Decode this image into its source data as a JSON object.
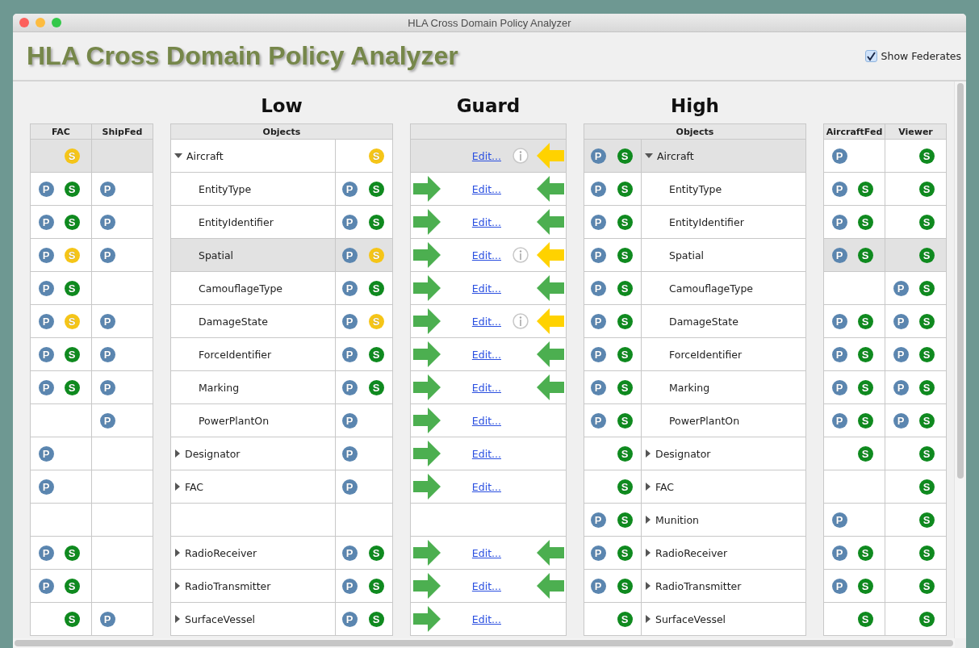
{
  "window": {
    "title": "HLA Cross Domain Policy Analyzer"
  },
  "header": {
    "title": "HLA Cross Domain Policy Analyzer",
    "show_federates": {
      "label": "Show Federates",
      "checked": true
    }
  },
  "sections": {
    "low": "Low",
    "guard": "Guard",
    "high": "High"
  },
  "low_federates": {
    "columns": [
      "FAC",
      "ShipFed"
    ]
  },
  "low_objects": {
    "column": "Objects"
  },
  "high_objects": {
    "column": "Objects"
  },
  "high_federates": {
    "columns": [
      "AircraftFed",
      "Viewer"
    ]
  },
  "rows": [
    {
      "expanded": true,
      "low_federates": {
        "highlighted": true,
        "cells": [
          {
            "s": {
              "text": "S",
              "color": "#f5c518"
            }
          },
          {}
        ]
      },
      "low": {
        "highlighted": false,
        "name": "Aircraft",
        "s": {
          "text": "S",
          "color": "#f5c518"
        }
      },
      "guard": {
        "highlighted": true,
        "link": "Edit...",
        "info": true,
        "back": {
          "color": "#ffd200"
        }
      },
      "high": {
        "highlighted": true,
        "name": "Aircraft",
        "p": {
          "text": "P",
          "color": "#5b86b0"
        },
        "s": {
          "text": "S",
          "color": "#0f8a1f"
        }
      },
      "high_federates": {
        "highlighted": false,
        "cells": [
          {
            "p": {
              "text": "P",
              "color": "#5b86b0"
            }
          },
          {
            "s": {
              "text": "S",
              "color": "#0f8a1f"
            }
          }
        ]
      },
      "children": [
        {
          "low_federates": {
            "highlighted": false,
            "cells": [
              {
                "p": {
                  "text": "P",
                  "color": "#5b86b0"
                },
                "s": {
                  "text": "S",
                  "color": "#0f8a1f"
                }
              },
              {
                "p": {
                  "text": "P",
                  "color": "#5b86b0"
                }
              }
            ]
          },
          "low": {
            "highlighted": false,
            "name": "EntityType",
            "p": {
              "text": "P",
              "color": "#5b86b0"
            },
            "s": {
              "text": "S",
              "color": "#0f8a1f"
            }
          },
          "guard": {
            "highlighted": false,
            "forward": {
              "color": "#4caf50"
            },
            "link": "Edit...",
            "info": false,
            "back": {
              "color": "#4caf50"
            }
          },
          "high": {
            "highlighted": false,
            "name": "EntityType",
            "p": {
              "text": "P",
              "color": "#5b86b0"
            },
            "s": {
              "text": "S",
              "color": "#0f8a1f"
            }
          },
          "high_federates": {
            "highlighted": false,
            "cells": [
              {
                "p": {
                  "text": "P",
                  "color": "#5b86b0"
                },
                "s": {
                  "text": "S",
                  "color": "#0f8a1f"
                }
              },
              {
                "s": {
                  "text": "S",
                  "color": "#0f8a1f"
                }
              }
            ]
          }
        },
        {
          "low_federates": {
            "highlighted": false,
            "cells": [
              {
                "p": {
                  "text": "P",
                  "color": "#5b86b0"
                },
                "s": {
                  "text": "S",
                  "color": "#0f8a1f"
                }
              },
              {
                "p": {
                  "text": "P",
                  "color": "#5b86b0"
                }
              }
            ]
          },
          "low": {
            "highlighted": false,
            "name": "EntityIdentifier",
            "p": {
              "text": "P",
              "color": "#5b86b0"
            },
            "s": {
              "text": "S",
              "color": "#0f8a1f"
            }
          },
          "guard": {
            "highlighted": false,
            "forward": {
              "color": "#4caf50"
            },
            "link": "Edit...",
            "info": false,
            "back": {
              "color": "#4caf50"
            }
          },
          "high": {
            "highlighted": false,
            "name": "EntityIdentifier",
            "p": {
              "text": "P",
              "color": "#5b86b0"
            },
            "s": {
              "text": "S",
              "color": "#0f8a1f"
            }
          },
          "high_federates": {
            "highlighted": false,
            "cells": [
              {
                "p": {
                  "text": "P",
                  "color": "#5b86b0"
                },
                "s": {
                  "text": "S",
                  "color": "#0f8a1f"
                }
              },
              {
                "s": {
                  "text": "S",
                  "color": "#0f8a1f"
                }
              }
            ]
          }
        },
        {
          "low_federates": {
            "highlighted": false,
            "cells": [
              {
                "p": {
                  "text": "P",
                  "color": "#5b86b0"
                },
                "s": {
                  "text": "S",
                  "color": "#f5c518"
                }
              },
              {
                "p": {
                  "text": "P",
                  "color": "#5b86b0"
                }
              }
            ]
          },
          "low": {
            "highlighted": true,
            "name": "Spatial",
            "p": {
              "text": "P",
              "color": "#5b86b0"
            },
            "s": {
              "text": "S",
              "color": "#f5c518"
            }
          },
          "guard": {
            "highlighted": false,
            "forward": {
              "color": "#4caf50"
            },
            "link": "Edit...",
            "info": true,
            "back": {
              "color": "#ffd200"
            }
          },
          "high": {
            "highlighted": false,
            "name": "Spatial",
            "p": {
              "text": "P",
              "color": "#5b86b0"
            },
            "s": {
              "text": "S",
              "color": "#0f8a1f"
            }
          },
          "high_federates": {
            "highlighted": true,
            "cells": [
              {
                "p": {
                  "text": "P",
                  "color": "#5b86b0"
                },
                "s": {
                  "text": "S",
                  "color": "#0f8a1f"
                }
              },
              {
                "s": {
                  "text": "S",
                  "color": "#0f8a1f"
                }
              }
            ]
          }
        },
        {
          "low_federates": {
            "highlighted": false,
            "cells": [
              {
                "p": {
                  "text": "P",
                  "color": "#5b86b0"
                },
                "s": {
                  "text": "S",
                  "color": "#0f8a1f"
                }
              },
              {}
            ]
          },
          "low": {
            "highlighted": false,
            "name": "CamouflageType",
            "p": {
              "text": "P",
              "color": "#5b86b0"
            },
            "s": {
              "text": "S",
              "color": "#0f8a1f"
            }
          },
          "guard": {
            "highlighted": false,
            "forward": {
              "color": "#4caf50"
            },
            "link": "Edit...",
            "info": false,
            "back": {
              "color": "#4caf50"
            }
          },
          "high": {
            "highlighted": false,
            "name": "CamouflageType",
            "p": {
              "text": "P",
              "color": "#5b86b0"
            },
            "s": {
              "text": "S",
              "color": "#0f8a1f"
            }
          },
          "high_federates": {
            "highlighted": false,
            "cells": [
              {},
              {
                "p": {
                  "text": "P",
                  "color": "#5b86b0"
                },
                "s": {
                  "text": "S",
                  "color": "#0f8a1f"
                }
              }
            ]
          }
        },
        {
          "low_federates": {
            "highlighted": false,
            "cells": [
              {
                "p": {
                  "text": "P",
                  "color": "#5b86b0"
                },
                "s": {
                  "text": "S",
                  "color": "#f5c518"
                }
              },
              {
                "p": {
                  "text": "P",
                  "color": "#5b86b0"
                }
              }
            ]
          },
          "low": {
            "highlighted": false,
            "name": "DamageState",
            "p": {
              "text": "P",
              "color": "#5b86b0"
            },
            "s": {
              "text": "S",
              "color": "#f5c518"
            }
          },
          "guard": {
            "highlighted": false,
            "forward": {
              "color": "#4caf50"
            },
            "link": "Edit...",
            "info": true,
            "back": {
              "color": "#ffd200"
            }
          },
          "high": {
            "highlighted": false,
            "name": "DamageState",
            "p": {
              "text": "P",
              "color": "#5b86b0"
            },
            "s": {
              "text": "S",
              "color": "#0f8a1f"
            }
          },
          "high_federates": {
            "highlighted": false,
            "cells": [
              {
                "p": {
                  "text": "P",
                  "color": "#5b86b0"
                },
                "s": {
                  "text": "S",
                  "color": "#0f8a1f"
                }
              },
              {
                "p": {
                  "text": "P",
                  "color": "#5b86b0"
                },
                "s": {
                  "text": "S",
                  "color": "#0f8a1f"
                }
              }
            ]
          }
        },
        {
          "low_federates": {
            "highlighted": false,
            "cells": [
              {
                "p": {
                  "text": "P",
                  "color": "#5b86b0"
                },
                "s": {
                  "text": "S",
                  "color": "#0f8a1f"
                }
              },
              {
                "p": {
                  "text": "P",
                  "color": "#5b86b0"
                }
              }
            ]
          },
          "low": {
            "highlighted": false,
            "name": "ForceIdentifier",
            "p": {
              "text": "P",
              "color": "#5b86b0"
            },
            "s": {
              "text": "S",
              "color": "#0f8a1f"
            }
          },
          "guard": {
            "highlighted": false,
            "forward": {
              "color": "#4caf50"
            },
            "link": "Edit...",
            "info": false,
            "back": {
              "color": "#4caf50"
            }
          },
          "high": {
            "highlighted": false,
            "name": "ForceIdentifier",
            "p": {
              "text": "P",
              "color": "#5b86b0"
            },
            "s": {
              "text": "S",
              "color": "#0f8a1f"
            }
          },
          "high_federates": {
            "highlighted": false,
            "cells": [
              {
                "p": {
                  "text": "P",
                  "color": "#5b86b0"
                },
                "s": {
                  "text": "S",
                  "color": "#0f8a1f"
                }
              },
              {
                "p": {
                  "text": "P",
                  "color": "#5b86b0"
                },
                "s": {
                  "text": "S",
                  "color": "#0f8a1f"
                }
              }
            ]
          }
        },
        {
          "low_federates": {
            "highlighted": false,
            "cells": [
              {
                "p": {
                  "text": "P",
                  "color": "#5b86b0"
                },
                "s": {
                  "text": "S",
                  "color": "#0f8a1f"
                }
              },
              {
                "p": {
                  "text": "P",
                  "color": "#5b86b0"
                }
              }
            ]
          },
          "low": {
            "highlighted": false,
            "name": "Marking",
            "p": {
              "text": "P",
              "color": "#5b86b0"
            },
            "s": {
              "text": "S",
              "color": "#0f8a1f"
            }
          },
          "guard": {
            "highlighted": false,
            "forward": {
              "color": "#4caf50"
            },
            "link": "Edit...",
            "info": false,
            "back": {
              "color": "#4caf50"
            }
          },
          "high": {
            "highlighted": false,
            "name": "Marking",
            "p": {
              "text": "P",
              "color": "#5b86b0"
            },
            "s": {
              "text": "S",
              "color": "#0f8a1f"
            }
          },
          "high_federates": {
            "highlighted": false,
            "cells": [
              {
                "p": {
                  "text": "P",
                  "color": "#5b86b0"
                },
                "s": {
                  "text": "S",
                  "color": "#0f8a1f"
                }
              },
              {
                "p": {
                  "text": "P",
                  "color": "#5b86b0"
                },
                "s": {
                  "text": "S",
                  "color": "#0f8a1f"
                }
              }
            ]
          }
        },
        {
          "low_federates": {
            "highlighted": false,
            "cells": [
              {},
              {
                "p": {
                  "text": "P",
                  "color": "#5b86b0"
                }
              }
            ]
          },
          "low": {
            "highlighted": false,
            "name": "PowerPlantOn",
            "p": {
              "text": "P",
              "color": "#5b86b0"
            }
          },
          "guard": {
            "highlighted": false,
            "forward": {
              "color": "#4caf50"
            },
            "link": "Edit...",
            "info": false
          },
          "high": {
            "highlighted": false,
            "name": "PowerPlantOn",
            "p": {
              "text": "P",
              "color": "#5b86b0"
            },
            "s": {
              "text": "S",
              "color": "#0f8a1f"
            }
          },
          "high_federates": {
            "highlighted": false,
            "cells": [
              {
                "p": {
                  "text": "P",
                  "color": "#5b86b0"
                },
                "s": {
                  "text": "S",
                  "color": "#0f8a1f"
                }
              },
              {
                "p": {
                  "text": "P",
                  "color": "#5b86b0"
                },
                "s": {
                  "text": "S",
                  "color": "#0f8a1f"
                }
              }
            ]
          }
        }
      ]
    },
    {
      "expanded": false,
      "low_federates": {
        "highlighted": false,
        "cells": [
          {
            "p": {
              "text": "P",
              "color": "#5b86b0"
            }
          },
          {}
        ]
      },
      "low": {
        "highlighted": false,
        "name": "Designator",
        "p": {
          "text": "P",
          "color": "#5b86b0"
        }
      },
      "guard": {
        "highlighted": false,
        "forward": {
          "color": "#4caf50"
        },
        "link": "Edit...",
        "info": false
      },
      "high": {
        "highlighted": false,
        "name": "Designator",
        "s": {
          "text": "S",
          "color": "#0f8a1f"
        }
      },
      "high_federates": {
        "highlighted": false,
        "cells": [
          {
            "s": {
              "text": "S",
              "color": "#0f8a1f"
            }
          },
          {
            "s": {
              "text": "S",
              "color": "#0f8a1f"
            }
          }
        ]
      }
    },
    {
      "expanded": false,
      "low_federates": {
        "highlighted": false,
        "cells": [
          {
            "p": {
              "text": "P",
              "color": "#5b86b0"
            }
          },
          {}
        ]
      },
      "low": {
        "highlighted": false,
        "name": "FAC",
        "p": {
          "text": "P",
          "color": "#5b86b0"
        }
      },
      "guard": {
        "highlighted": false,
        "forward": {
          "color": "#4caf50"
        },
        "link": "Edit...",
        "info": false
      },
      "high": {
        "highlighted": false,
        "name": "FAC",
        "s": {
          "text": "S",
          "color": "#0f8a1f"
        }
      },
      "high_federates": {
        "highlighted": false,
        "cells": [
          {},
          {
            "s": {
              "text": "S",
              "color": "#0f8a1f"
            }
          }
        ]
      }
    },
    {
      "expanded": false,
      "low_federates": {
        "highlighted": false,
        "cells": [
          {},
          {}
        ]
      },
      "low": {
        "highlighted": false
      },
      "guard": {
        "highlighted": false,
        "info": false
      },
      "high": {
        "highlighted": false,
        "name": "Munition",
        "p": {
          "text": "P",
          "color": "#5b86b0"
        },
        "s": {
          "text": "S",
          "color": "#0f8a1f"
        }
      },
      "high_federates": {
        "highlighted": false,
        "cells": [
          {
            "p": {
              "text": "P",
              "color": "#5b86b0"
            }
          },
          {
            "s": {
              "text": "S",
              "color": "#0f8a1f"
            }
          }
        ]
      }
    },
    {
      "expanded": false,
      "low_federates": {
        "highlighted": false,
        "cells": [
          {
            "p": {
              "text": "P",
              "color": "#5b86b0"
            },
            "s": {
              "text": "S",
              "color": "#0f8a1f"
            }
          },
          {}
        ]
      },
      "low": {
        "highlighted": false,
        "name": "RadioReceiver",
        "p": {
          "text": "P",
          "color": "#5b86b0"
        },
        "s": {
          "text": "S",
          "color": "#0f8a1f"
        }
      },
      "guard": {
        "highlighted": false,
        "forward": {
          "color": "#4caf50"
        },
        "link": "Edit...",
        "info": false,
        "back": {
          "color": "#4caf50"
        }
      },
      "high": {
        "highlighted": false,
        "name": "RadioReceiver",
        "p": {
          "text": "P",
          "color": "#5b86b0"
        },
        "s": {
          "text": "S",
          "color": "#0f8a1f"
        }
      },
      "high_federates": {
        "highlighted": false,
        "cells": [
          {
            "p": {
              "text": "P",
              "color": "#5b86b0"
            },
            "s": {
              "text": "S",
              "color": "#0f8a1f"
            }
          },
          {
            "s": {
              "text": "S",
              "color": "#0f8a1f"
            }
          }
        ]
      }
    },
    {
      "expanded": false,
      "low_federates": {
        "highlighted": false,
        "cells": [
          {
            "p": {
              "text": "P",
              "color": "#5b86b0"
            },
            "s": {
              "text": "S",
              "color": "#0f8a1f"
            }
          },
          {}
        ]
      },
      "low": {
        "highlighted": false,
        "name": "RadioTransmitter",
        "p": {
          "text": "P",
          "color": "#5b86b0"
        },
        "s": {
          "text": "S",
          "color": "#0f8a1f"
        }
      },
      "guard": {
        "highlighted": false,
        "forward": {
          "color": "#4caf50"
        },
        "link": "Edit...",
        "info": false,
        "back": {
          "color": "#4caf50"
        }
      },
      "high": {
        "highlighted": false,
        "name": "RadioTransmitter",
        "p": {
          "text": "P",
          "color": "#5b86b0"
        },
        "s": {
          "text": "S",
          "color": "#0f8a1f"
        }
      },
      "high_federates": {
        "highlighted": false,
        "cells": [
          {
            "p": {
              "text": "P",
              "color": "#5b86b0"
            },
            "s": {
              "text": "S",
              "color": "#0f8a1f"
            }
          },
          {
            "s": {
              "text": "S",
              "color": "#0f8a1f"
            }
          }
        ]
      }
    },
    {
      "expanded": false,
      "low_federates": {
        "highlighted": false,
        "cells": [
          {
            "s": {
              "text": "S",
              "color": "#0f8a1f"
            }
          },
          {
            "p": {
              "text": "P",
              "color": "#5b86b0"
            }
          }
        ]
      },
      "low": {
        "highlighted": false,
        "name": "SurfaceVessel",
        "p": {
          "text": "P",
          "color": "#5b86b0"
        },
        "s": {
          "text": "S",
          "color": "#0f8a1f"
        }
      },
      "guard": {
        "highlighted": false,
        "forward": {
          "color": "#4caf50"
        },
        "link": "Edit...",
        "info": false
      },
      "high": {
        "highlighted": false,
        "name": "SurfaceVessel",
        "s": {
          "text": "S",
          "color": "#0f8a1f"
        }
      },
      "high_federates": {
        "highlighted": false,
        "cells": [
          {
            "s": {
              "text": "S",
              "color": "#0f8a1f"
            }
          },
          {
            "s": {
              "text": "S",
              "color": "#0f8a1f"
            }
          }
        ]
      }
    }
  ]
}
